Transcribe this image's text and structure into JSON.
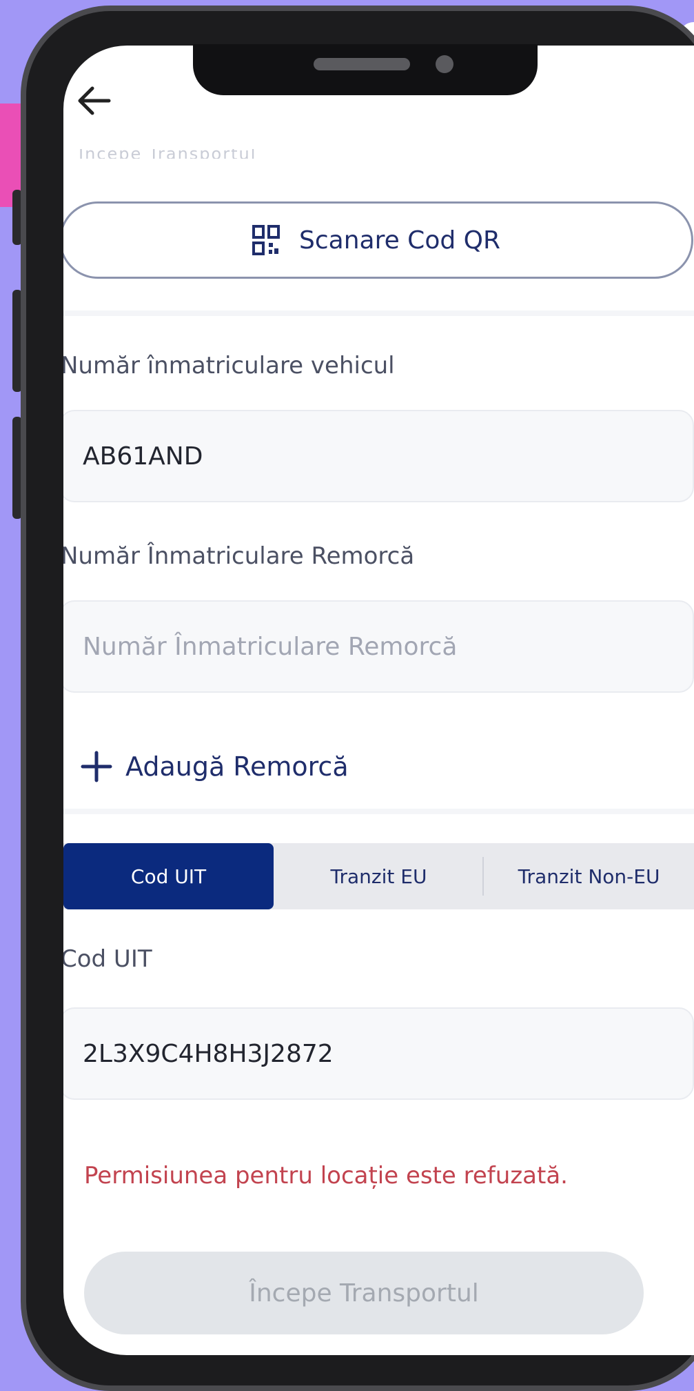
{
  "header": {
    "back_icon": "arrow-left-icon",
    "faded_section_label": "Începe Transportul"
  },
  "qr": {
    "icon": "qr-code-icon",
    "label": "Scanare Cod QR"
  },
  "vehicle": {
    "label": "Număr înmatriculare vehicul",
    "value": "AB61AND"
  },
  "trailer": {
    "label": "Număr Înmatriculare Remorcă",
    "placeholder": "Număr Înmatriculare Remorcă",
    "add_icon": "plus-icon",
    "add_label": "Adaugă Remorcă"
  },
  "tabs": [
    {
      "label": "Cod UIT",
      "active": true
    },
    {
      "label": "Tranzit EU",
      "active": false
    },
    {
      "label": "Tranzit Non-EU",
      "active": false
    }
  ],
  "uit": {
    "label": "Cod UIT",
    "value": "2L3X9C4H8H3J2872"
  },
  "status": {
    "error": "Permisiunea pentru locație este refuzată."
  },
  "actions": {
    "start_label": "Începe Transportul"
  },
  "colors": {
    "background": "#a197f6",
    "accent_pink": "#ea4fb6",
    "primary_navy": "#0b2a7e",
    "error_red": "#c2434f",
    "disabled_gray": "#e2e5e9"
  }
}
